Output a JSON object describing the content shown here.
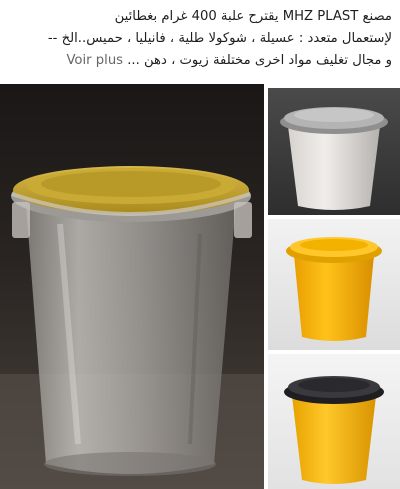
{
  "post": {
    "text_line_1": "مصنع MHZ PLAST  يقترح علبة  400 غرام بغطائين",
    "text_line_2": "لإستعمال متعدد  : عسيلة ، شوكولا طلية ، فانيليا ، حميس..الخ --",
    "text_line_3": "و مجال تغليف مواد اخرى مختلفة زيوت ، دهن ... ",
    "see_more_label": "Voir plus"
  },
  "gallery": {
    "photos": [
      {
        "subject": "clear-container-yellow-lid"
      },
      {
        "subject": "grey-container-grey-lid"
      },
      {
        "subject": "yellow-container-yellow-lid"
      },
      {
        "subject": "yellow-container-black-lid"
      }
    ]
  },
  "colors": {
    "text": "#1c1e21",
    "see_more": "#65676b",
    "yellow": "#f5b400",
    "grey_lid": "#c9c9c9",
    "dark_lid": "#2f2f33"
  }
}
